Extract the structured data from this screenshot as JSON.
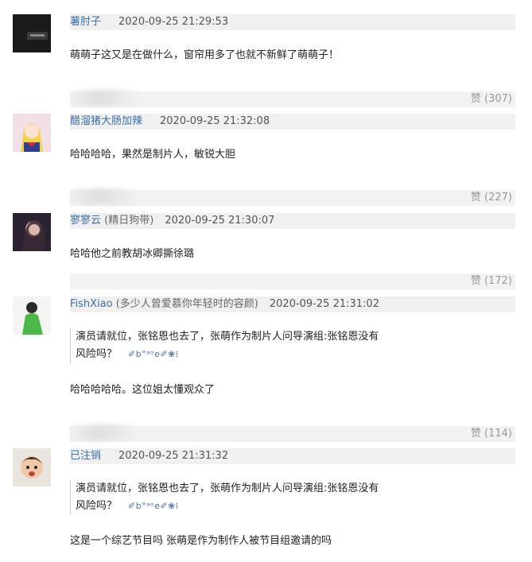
{
  "comments": [
    {
      "username": "薯肘子",
      "note": "",
      "time": "2020-09-25 21:29:53",
      "text": "萌萌子这又是在做什么，窗帘用多了也就不新鲜了萌萌子！",
      "likes": "赞 (307)"
    },
    {
      "username": "醋溜猪大肠加辣",
      "note": "",
      "time": "2020-09-25 21:32:08",
      "text": "哈哈哈哈，果然是制片人，敏锐大胆",
      "likes": "赞 (227)"
    },
    {
      "username": "寥寥云",
      "note": "(精日狗带)",
      "time": "2020-09-25 21:30:07",
      "text": "哈哈他之前教胡冰卿撕徐璐",
      "likes": "赞 (172)"
    },
    {
      "username": "FishXiao",
      "note": "(多少人曾爱慕你年轻时的容颜)",
      "time": "2020-09-25 21:31:02",
      "quote_line1": "演员请就位，张铭恩也去了，张萌作为制片人问导演组:张铭恩没有",
      "quote_line2": "风险吗？",
      "quote_emoticon": "✐b°ᵃᵒe✐❀⁞",
      "text": "哈哈哈哈哈。这位姐太懂观众了",
      "likes": "赞 (114)"
    },
    {
      "username": "已注销",
      "note": "",
      "time": "2020-09-25 21:31:32",
      "quote_line1": "演员请就位，张铭恩也去了，张萌作为制片人问导演组:张铭恩没有",
      "quote_line2": "风险吗？",
      "quote_emoticon": "✐b°ᵃᵒe✐❀⁞",
      "text": "这是一个综艺节目吗 张萌是作为制作人被节目组邀请的吗"
    }
  ]
}
